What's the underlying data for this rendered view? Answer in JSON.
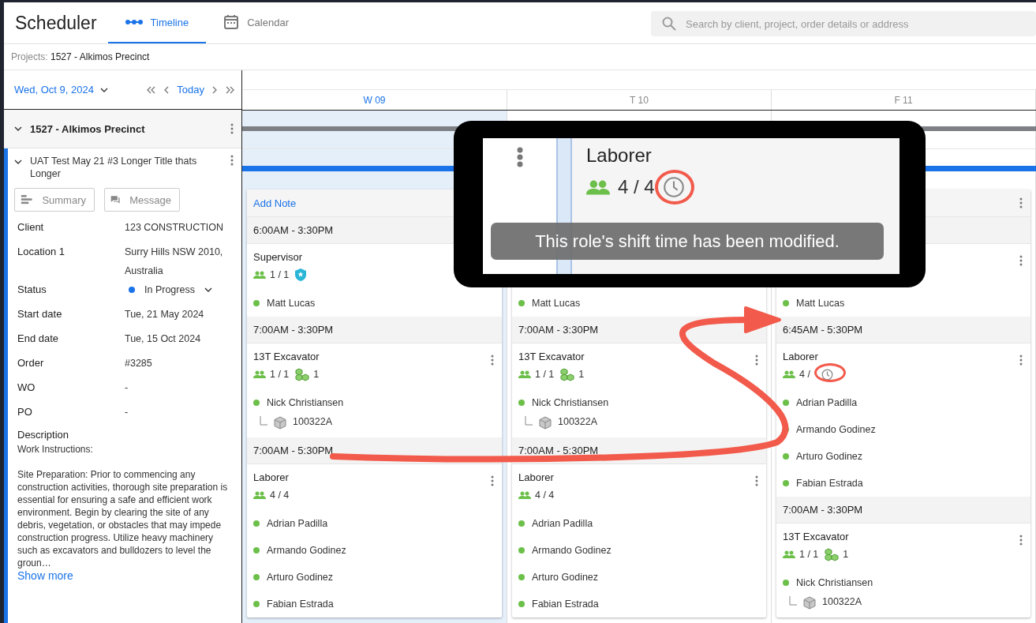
{
  "app": {
    "title": "Scheduler"
  },
  "tabs": [
    {
      "label": "Timeline",
      "kind": "timeline",
      "selected": true
    },
    {
      "label": "Calendar",
      "kind": "calendar",
      "selected": false
    }
  ],
  "search": {
    "placeholder": "Search by client, project, order details or address"
  },
  "breadcrumb": {
    "label": "Projects:",
    "value": "1527 - Alkimos Precinct"
  },
  "date_nav": {
    "date": "Wed, Oct 9, 2024",
    "today": "Today"
  },
  "project": {
    "title": "1527 - Alkimos Precinct",
    "expanded": true
  },
  "job": {
    "title": "UAT Test May 21 #3 Longer Title thats Longer",
    "expanded": true,
    "selected": true
  },
  "job_actions": [
    {
      "label": "Summary",
      "kind": "summary"
    },
    {
      "label": "Message",
      "kind": "message"
    }
  ],
  "details": [
    {
      "label": "Client",
      "value": "123 CONSTRUCTION"
    },
    {
      "label": "Location 1",
      "value": "Surry Hills NSW 2010, Australia"
    },
    {
      "label": "Status",
      "value": "In Progress",
      "kind": "status",
      "color": "#1a73e8"
    },
    {
      "label": "Start date",
      "value": "Tue, 21 May 2024"
    },
    {
      "label": "End date",
      "value": "Tue, 15 Oct 2024"
    },
    {
      "label": "Order",
      "value": "#3285"
    },
    {
      "label": "WO",
      "value": "-"
    },
    {
      "label": "PO",
      "value": "-"
    }
  ],
  "description": {
    "label": "Description",
    "paragraphs": [
      "Work Instructions:",
      "Site Preparation: Prior to commencing any construction activities, thorough site preparation is essential for ensuring a safe and efficient work environment. Begin by clearing the site of any debris, vegetation, or obstacles that may impede construction progress. Utilize heavy machinery such as excavators and bulldozers to level the groun…"
    ],
    "more": "Show more"
  },
  "days": [
    {
      "label": "W 09",
      "selected": true
    },
    {
      "label": "T 10",
      "selected": false
    },
    {
      "label": "F 11",
      "selected": false
    }
  ],
  "columns": [
    {
      "sections": [
        {
          "kind": "note",
          "label": "Add Note"
        },
        {
          "kind": "shift",
          "time": "6:00AM - 3:30PM"
        },
        {
          "kind": "role",
          "name": "Supervisor",
          "count": "1 / 1",
          "badges": [
            {
              "kind": "supervisor"
            }
          ]
        },
        {
          "kind": "person",
          "name": "Matt Lucas"
        },
        {
          "kind": "shift",
          "time": "7:00AM - 3:30PM"
        },
        {
          "kind": "role",
          "name": "13T Excavator",
          "count": "1 / 1",
          "menu": true,
          "badges": [
            {
              "kind": "equipment",
              "count": "1"
            }
          ]
        },
        {
          "kind": "person",
          "name": "Nick Christiansen"
        },
        {
          "kind": "asset",
          "name": "100322A"
        },
        {
          "kind": "shift",
          "time": "7:00AM - 5:30PM"
        },
        {
          "kind": "role",
          "name": "Laborer",
          "count": "4 / 4",
          "menu": true
        },
        {
          "kind": "person",
          "name": "Adrian Padilla"
        },
        {
          "kind": "person",
          "name": "Armando Godinez"
        },
        {
          "kind": "person",
          "name": "Arturo Godinez"
        },
        {
          "kind": "person",
          "name": "Fabian Estrada"
        }
      ]
    },
    {
      "sections": [
        {
          "kind": "covered"
        },
        {
          "kind": "person",
          "name": "Matt Lucas"
        },
        {
          "kind": "shift",
          "time": "7:00AM - 3:30PM"
        },
        {
          "kind": "role",
          "name": "13T Excavator",
          "count": "1 / 1",
          "menu": true,
          "badges": [
            {
              "kind": "equipment",
              "count": "1"
            }
          ]
        },
        {
          "kind": "person",
          "name": "Nick Christiansen"
        },
        {
          "kind": "asset",
          "name": "100322A"
        },
        {
          "kind": "shift",
          "time": "7:00AM - 5:30PM"
        },
        {
          "kind": "role",
          "name": "Laborer",
          "count": "4 / 4",
          "menu": true
        },
        {
          "kind": "person",
          "name": "Adrian Padilla"
        },
        {
          "kind": "person",
          "name": "Armando Godinez"
        },
        {
          "kind": "person",
          "name": "Arturo Godinez"
        },
        {
          "kind": "person",
          "name": "Fabian Estrada"
        }
      ]
    },
    {
      "sections": [
        {
          "kind": "note",
          "menu": true
        },
        {
          "kind": "shift"
        },
        {
          "kind": "role",
          "menu": true
        },
        {
          "kind": "person",
          "name": "Matt Lucas"
        },
        {
          "kind": "shift",
          "time": "6:45AM - 5:30PM"
        },
        {
          "kind": "role",
          "name": "Laborer",
          "count": "4 /",
          "menu": true,
          "badges": [
            {
              "kind": "modified",
              "circled": true
            }
          ]
        },
        {
          "kind": "person",
          "name": "Adrian Padilla"
        },
        {
          "kind": "person",
          "name": "Armando Godinez"
        },
        {
          "kind": "person",
          "name": "Arturo Godinez"
        },
        {
          "kind": "person",
          "name": "Fabian Estrada"
        },
        {
          "kind": "shift",
          "time": "7:00AM - 3:30PM"
        },
        {
          "kind": "role",
          "name": "13T Excavator",
          "count": "1 / 1",
          "menu": true,
          "badges": [
            {
              "kind": "equipment",
              "count": "1"
            }
          ]
        },
        {
          "kind": "person",
          "name": "Nick Christiansen"
        },
        {
          "kind": "asset",
          "name": "100322A"
        }
      ]
    }
  ],
  "callout": {
    "role": "Laborer",
    "count": "4 / 4",
    "tooltip": "This role's shift time has been modified.",
    "circled": true
  }
}
